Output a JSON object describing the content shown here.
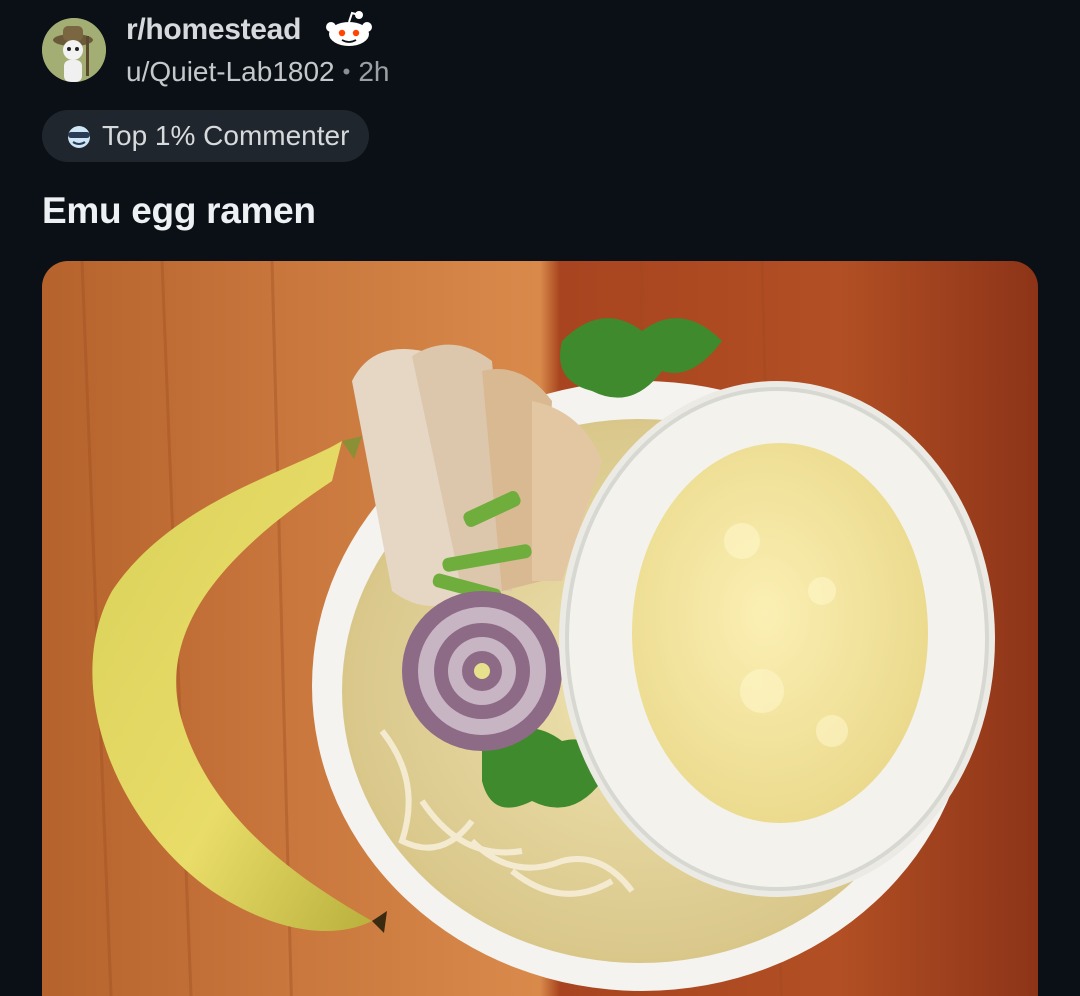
{
  "post": {
    "subreddit": "r/homestead",
    "author": "u/Quiet-Lab1802",
    "separator": "•",
    "age": "2h",
    "title": "Emu egg ramen"
  },
  "badge": {
    "label": "Top 1% Commenter",
    "icon": "sunglasses-icon"
  },
  "icons": {
    "avatar": "user-avatar",
    "subreddit": "snoo-icon"
  },
  "colors": {
    "background": "#0b1016",
    "badge_bg": "#1f262d",
    "text_primary": "#eef1f3",
    "text_secondary": "#9ba0a5"
  }
}
